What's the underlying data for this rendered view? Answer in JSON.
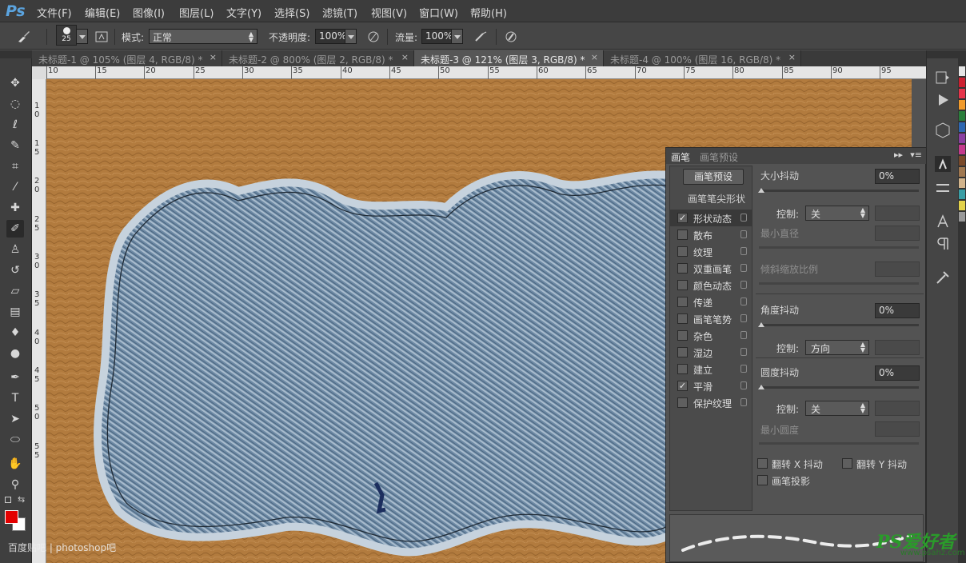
{
  "app": {
    "logo": "Ps"
  },
  "menu": [
    "文件(F)",
    "编辑(E)",
    "图像(I)",
    "图层(L)",
    "文字(Y)",
    "选择(S)",
    "滤镜(T)",
    "视图(V)",
    "窗口(W)",
    "帮助(H)"
  ],
  "options": {
    "brush_size": "25",
    "mode_label": "模式:",
    "mode_value": "正常",
    "opacity_label": "不透明度:",
    "opacity_value": "100%",
    "flow_label": "流量:",
    "flow_value": "100%"
  },
  "tabs": [
    {
      "label": "未标题-1 @ 105% (图层 4, RGB/8) *",
      "close": "×"
    },
    {
      "label": "未标题-2 @ 800% (图层 2, RGB/8) *",
      "close": "×"
    },
    {
      "label": "未标题-3 @ 121% (图层 3, RGB/8) *",
      "close": "×"
    },
    {
      "label": "未标题-4 @ 100% (图层 16, RGB/8) *",
      "close": "×"
    }
  ],
  "ruler_top": [
    "10",
    "15",
    "20",
    "25",
    "30",
    "35",
    "40",
    "45",
    "50",
    "55",
    "60",
    "65",
    "70",
    "75",
    "80",
    "85",
    "90",
    "95"
  ],
  "ruler_left": [
    "10",
    "15",
    "20",
    "25",
    "30",
    "35",
    "40",
    "45",
    "50",
    "55"
  ],
  "brush_panel": {
    "tab_brush": "画笔",
    "tab_presets": "画笔预设",
    "preset_button": "画笔预设",
    "tip_shape": "画笔笔尖形状",
    "options": [
      {
        "label": "形状动态",
        "checked": "✓"
      },
      {
        "label": "散布",
        "checked": ""
      },
      {
        "label": "纹理",
        "checked": ""
      },
      {
        "label": "双重画笔",
        "checked": ""
      },
      {
        "label": "颜色动态",
        "checked": ""
      },
      {
        "label": "传递",
        "checked": ""
      },
      {
        "label": "画笔笔势",
        "checked": ""
      },
      {
        "label": "杂色",
        "checked": ""
      },
      {
        "label": "湿边",
        "checked": ""
      },
      {
        "label": "建立",
        "checked": ""
      },
      {
        "label": "平滑",
        "checked": "✓"
      },
      {
        "label": "保护纹理",
        "checked": ""
      }
    ],
    "size_jitter_label": "大小抖动",
    "size_jitter_value": "0%",
    "control_label": "控制:",
    "control_off": "关",
    "min_diameter_label": "最小直径",
    "tilt_scale_label": "倾斜缩放比例",
    "angle_jitter_label": "角度抖动",
    "angle_jitter_value": "0%",
    "angle_control_value": "方向",
    "roundness_jitter_label": "圆度抖动",
    "roundness_jitter_value": "0%",
    "roundness_control_value": "关",
    "min_roundness_label": "最小圆度",
    "flip_x_label": "翻转 X 抖动",
    "flip_y_label": "翻转 Y 抖动",
    "brush_projection_label": "画笔投影"
  },
  "watermark": {
    "brand": "PS爱好者",
    "url": "www.psahz.com",
    "baidu": "百度贴吧 | photoshop吧"
  },
  "colors": {
    "foreground": "#e30000",
    "background": "#ffffff",
    "highlight": "#e0001a"
  }
}
